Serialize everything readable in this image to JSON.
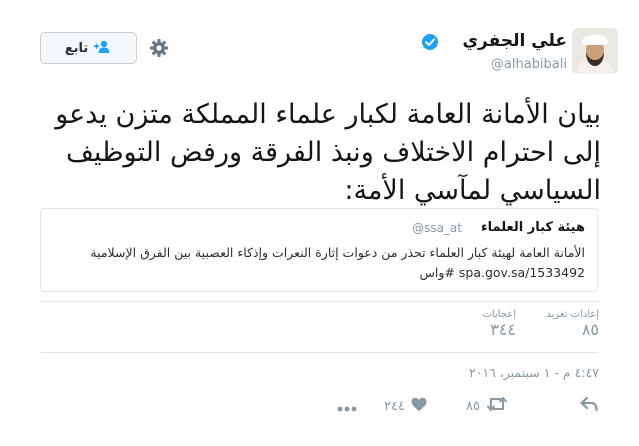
{
  "header": {
    "name": "علي الجفري",
    "handle": "@alhabibali",
    "follow_label": "تابع",
    "verified_icon": "verified-badge-icon"
  },
  "tweet": {
    "text": "بيان الأمانة العامة لكبار علماء المملكة متزن يدعو إلى احترام الاختلاف ونبذ الفرقة ورفض التوظيف السياسي لمآسي الأمة:"
  },
  "quote": {
    "name": "هيئة كبار العلماء",
    "handle": "@ssa_at",
    "text": "الأمانة العامة لهيئة كبار العلماء تحذر من دعوات إثارة النعرات وإذكاء العصبية بين الفرق الإسلامية",
    "link": "spa.gov.sa/1533492",
    "hashtag": "#واس"
  },
  "stats": {
    "retweets_label": "إعادات تغريد",
    "retweets_value": "٨٥",
    "likes_label": "إعجابات",
    "likes_value": "٣٤٤"
  },
  "timestamp": "٤:٤٧ م - ١ سبتمبر، ٢٠١٦",
  "actions": {
    "retweet_count": "٨٥",
    "like_count": "٢٤٤"
  },
  "colors": {
    "text": "#14171a",
    "muted": "#8899a6",
    "verified": "#1da1f2",
    "border": "#e1e8ed"
  }
}
